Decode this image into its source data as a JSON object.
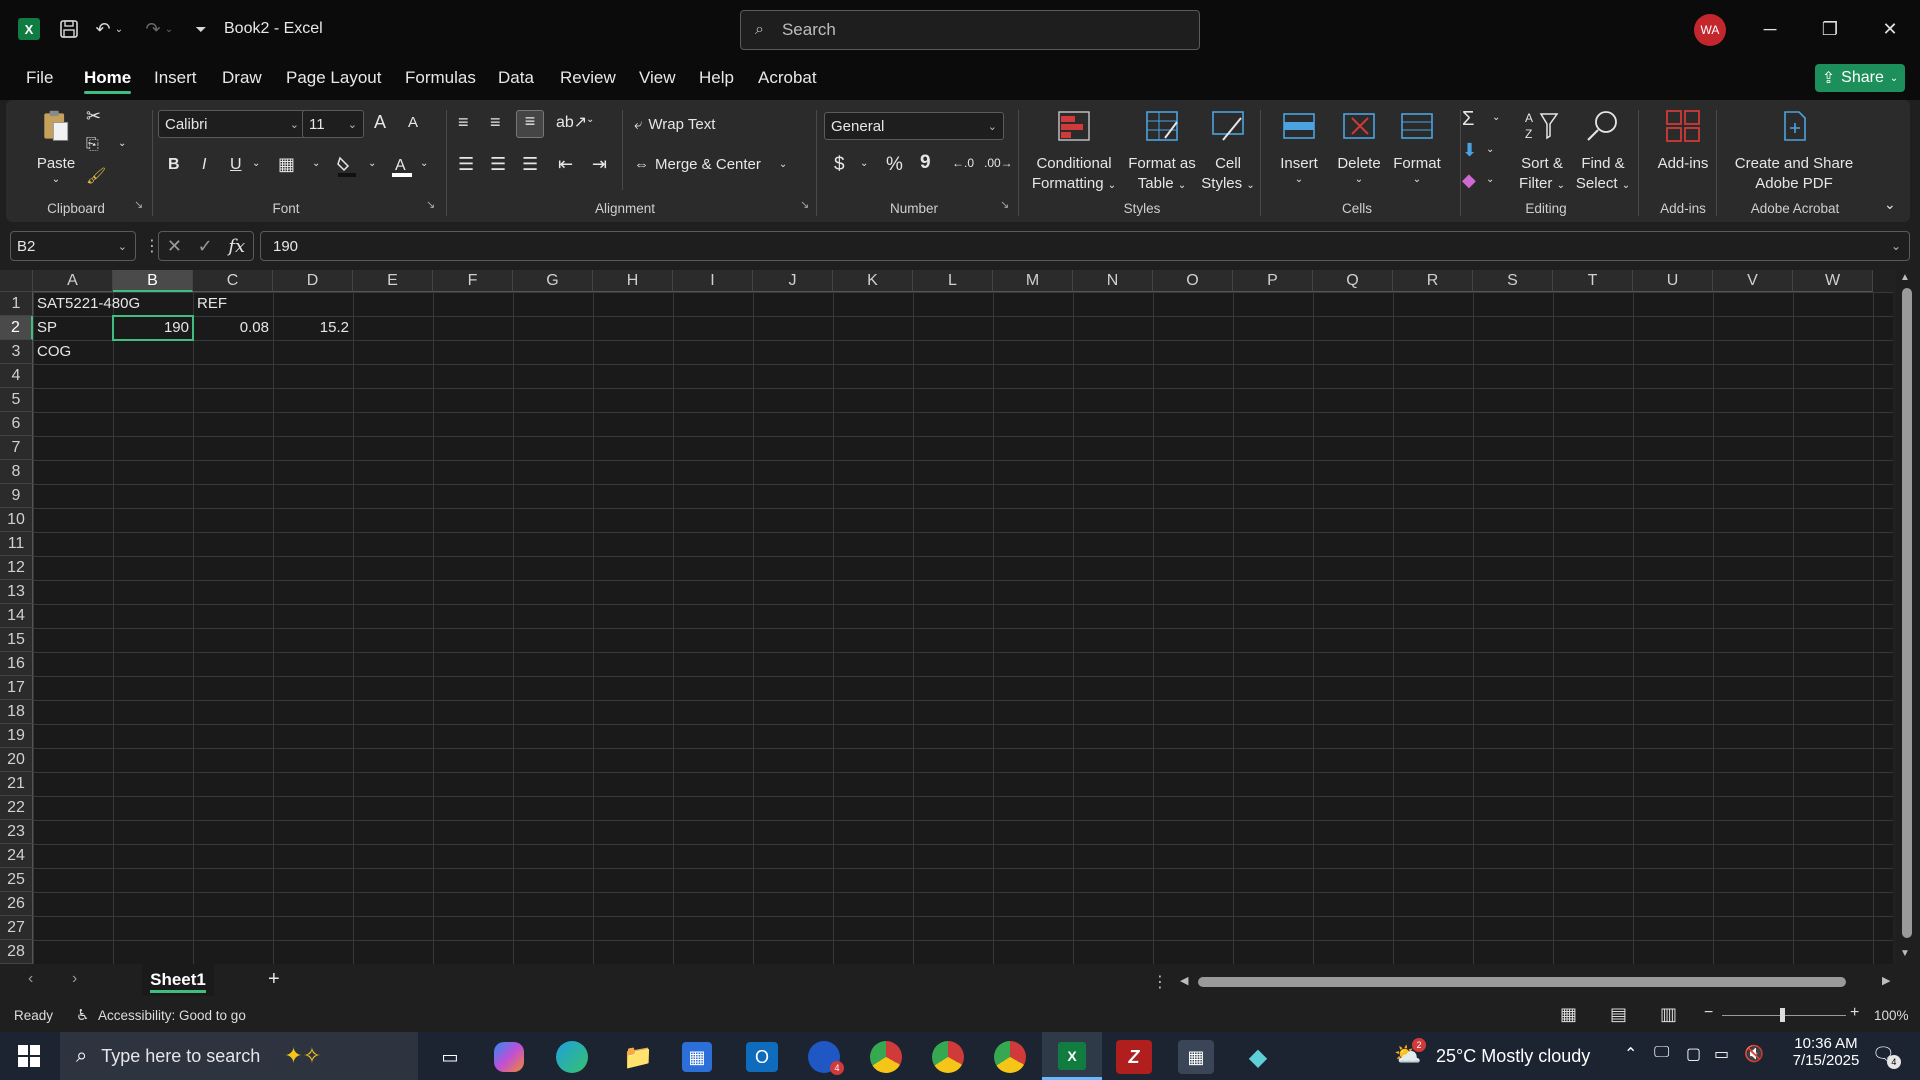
{
  "app": {
    "title": "Book2  -  Excel",
    "logo_letter": "X",
    "search_placeholder": "Search",
    "avatar_initials": "WA",
    "colors": {
      "excel_green": "#107c41",
      "accent": "#3fbf7f",
      "avatar": "#c4262e"
    }
  },
  "menu": {
    "tabs": [
      "File",
      "Home",
      "Insert",
      "Draw",
      "Page Layout",
      "Formulas",
      "Data",
      "Review",
      "View",
      "Help",
      "Acrobat"
    ],
    "active": "Home",
    "share_label": "Share"
  },
  "ribbon": {
    "clipboard": {
      "paste": "Paste",
      "label": "Clipboard"
    },
    "font": {
      "family": "Calibri",
      "size": "11",
      "label": "Font",
      "bold": "B",
      "italic": "I",
      "underline": "U",
      "grow": "A",
      "shrink": "A"
    },
    "alignment": {
      "wrap_text": "Wrap Text",
      "merge_center": "Merge & Center",
      "label": "Alignment"
    },
    "number": {
      "format": "General",
      "label": "Number",
      "currency": "$",
      "percent": "%",
      "comma": "9"
    },
    "styles": {
      "conditional": [
        "Conditional",
        "Formatting"
      ],
      "format_table": [
        "Format as",
        "Table"
      ],
      "cell_styles": [
        "Cell",
        "Styles"
      ],
      "label": "Styles"
    },
    "cells": {
      "insert": "Insert",
      "delete": "Delete",
      "format": "Format",
      "label": "Cells"
    },
    "editing": {
      "sort_filter": [
        "Sort &",
        "Filter"
      ],
      "find_select": [
        "Find &",
        "Select"
      ],
      "label": "Editing"
    },
    "addins": {
      "addins": "Add-ins",
      "label": "Add-ins"
    },
    "acrobat": {
      "create": [
        "Create and Share",
        "Adobe PDF"
      ],
      "label": "Adobe Acrobat"
    }
  },
  "formula_bar": {
    "name_box": "B2",
    "fx": "fx",
    "content": "190"
  },
  "grid": {
    "columns": [
      "A",
      "B",
      "C",
      "D",
      "E",
      "F",
      "G",
      "H",
      "I",
      "J",
      "K",
      "L",
      "M",
      "N",
      "O",
      "P",
      "Q",
      "R",
      "S",
      "T",
      "U",
      "V",
      "W"
    ],
    "rows": [
      "1",
      "2",
      "3",
      "4",
      "5",
      "6",
      "7",
      "8",
      "9",
      "10",
      "11",
      "12",
      "13",
      "14",
      "15",
      "16",
      "17",
      "18",
      "19",
      "20",
      "21",
      "22",
      "23",
      "24",
      "25",
      "26",
      "27",
      "28"
    ],
    "selected_column": "B",
    "selected_row": "2",
    "cells": {
      "A1": "SAT5221-480G",
      "C1": "REF",
      "A2": "SP",
      "B2": "190",
      "C2": "0.08",
      "D2": "15.2",
      "A3": "COG"
    }
  },
  "sheets": {
    "tabs": [
      "Sheet1"
    ],
    "active": "Sheet1",
    "add_label": "+"
  },
  "status": {
    "ready": "Ready",
    "accessibility": "Accessibility: Good to go",
    "zoom": "100%"
  },
  "taskbar": {
    "search_placeholder": "Type here to search",
    "weather": "25°C  Mostly cloudy",
    "time": "10:36 AM",
    "date": "7/15/2025",
    "notifications": "4",
    "weather_badge": "2",
    "outlook_badge": "4"
  }
}
